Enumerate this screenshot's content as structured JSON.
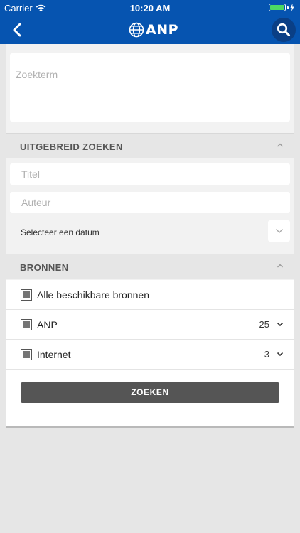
{
  "status_bar": {
    "carrier": "Carrier",
    "time": "10:20 AM"
  },
  "nav": {
    "logo_text": "ANP",
    "back_icon": "chevron-left-icon",
    "search_icon": "search-icon",
    "brand_color": "#0654b0"
  },
  "search": {
    "placeholder": "Zoekterm"
  },
  "advanced": {
    "heading": "UITGEBREID ZOEKEN",
    "title_placeholder": "Titel",
    "author_placeholder": "Auteur",
    "date_label": "Selecteer een datum"
  },
  "sources": {
    "heading": "BRONNEN",
    "items": [
      {
        "label": "Alle beschikbare bronnen",
        "count": ""
      },
      {
        "label": "ANP",
        "count": "25"
      },
      {
        "label": "Internet",
        "count": "3"
      }
    ]
  },
  "submit_label": "ZOEKEN"
}
